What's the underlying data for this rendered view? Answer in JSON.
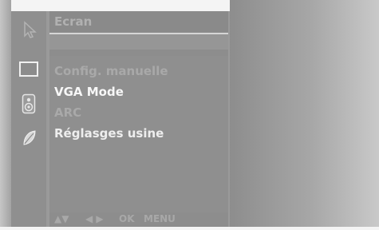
{
  "menu": {
    "title": "Ecran",
    "items": [
      {
        "label": "Config. manuelle",
        "state": "disabled"
      },
      {
        "label": "VGA Mode",
        "state": "selected"
      },
      {
        "label": "ARC",
        "state": "disabled"
      },
      {
        "label": "Réglasges usine",
        "state": "enabled"
      }
    ]
  },
  "side_icons": [
    "pointer-icon",
    "screen-icon",
    "speaker-icon",
    "leaf-icon"
  ],
  "footer": {
    "updown": "▲▼",
    "leftright": "◀ ▶",
    "ok": "OK",
    "menu": "MENU"
  },
  "colors": {
    "panel_bg": "#8d8d8d",
    "selected_text": "#f7f7f7",
    "disabled_text": "#a9a9a9"
  }
}
